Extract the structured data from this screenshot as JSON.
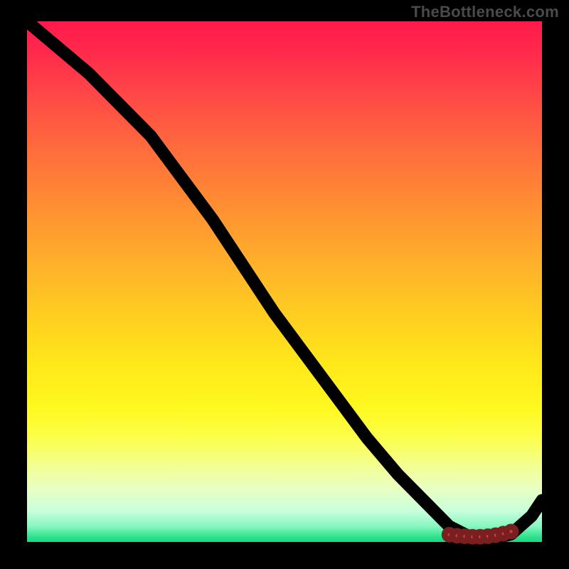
{
  "watermark": "TheBottleneck.com",
  "colors": {
    "background": "#000000",
    "curve": "#000000",
    "dot_fill": "#c9403f",
    "dot_stroke": "#7a1f1f",
    "gradient_top": "#ff1a4b",
    "gradient_bottom": "#14d97e"
  },
  "chart_data": {
    "type": "line",
    "title": "",
    "xlabel": "",
    "ylabel": "",
    "xlim": [
      0,
      100
    ],
    "ylim": [
      0,
      100
    ],
    "notes": "Axis is unlabeled; values are read as percentages of the plotting area (0 at left/bottom, 100 at right/top).",
    "series": [
      {
        "name": "curve",
        "x": [
          0,
          6,
          12,
          18,
          24,
          30,
          36,
          42,
          48,
          54,
          60,
          66,
          72,
          78,
          82,
          86,
          90,
          94,
          98,
          100
        ],
        "y": [
          100,
          95,
          90,
          84,
          78,
          70,
          62,
          53,
          44,
          36,
          28,
          20,
          13,
          7,
          3,
          1,
          0.5,
          1.5,
          5,
          8
        ]
      }
    ],
    "markers": {
      "name": "valley-dots",
      "x": [
        82,
        83.5,
        85,
        86.5,
        88,
        89.5,
        91,
        92.5,
        94
      ],
      "y": [
        1.4,
        1.2,
        1.1,
        1.0,
        1.0,
        1.1,
        1.3,
        1.6,
        2.0
      ]
    }
  }
}
